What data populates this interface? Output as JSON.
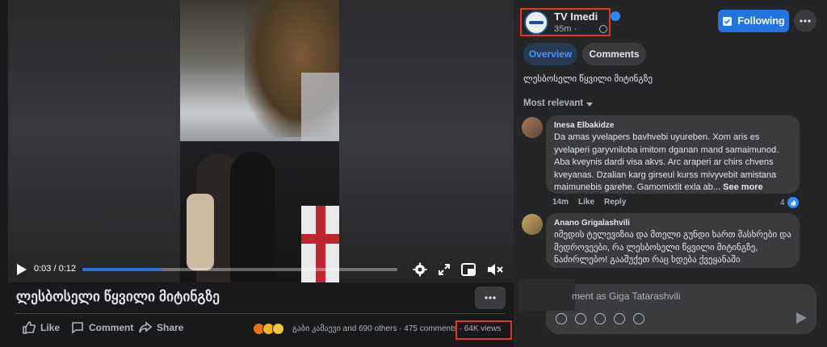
{
  "video": {
    "time_display": "0:03 / 0:12",
    "progress_fraction": 0.25
  },
  "post": {
    "title": "ლესბოსელი წყვილი მიტინგზე",
    "actions": {
      "like": "Like",
      "comment": "Comment",
      "share": "Share"
    },
    "stats": "გაბი კამაევი and 690 others  ·  475 comments  ·  64K views"
  },
  "page": {
    "name": "TV Imedi",
    "time": "35m ·",
    "follow_label": "Following"
  },
  "tabs": [
    {
      "label": "Overview",
      "active": true
    },
    {
      "label": "Comments",
      "active": false
    }
  ],
  "description": "ლესბოსელი წყვილი მიტინგზე",
  "sort_label": "Most relevant",
  "comments": [
    {
      "author": "Inesa Elbakidze",
      "text": "Da amas yvelapers bavhvebi uyureben. Xom aris es yvelaperi garyvniloba imitom dganan mand samaimunod. Aba kveynis dardi visa akvs. Arc araperi ar chirs chvens kveyanas. Dzalian karg girseul kurss mivyvebit amistana maimunebis garehe. Gamomixtit exla ab...",
      "see_more": "See more",
      "time": "14m",
      "like": "Like",
      "reply": "Reply",
      "reactions": "4"
    },
    {
      "author": "Anano Grigalashvili",
      "text": "იმედის ტელევიზია და მთელი გუნდი ხართ მასხრები და მედროვეები, რა ლესბოსელი წყვილი მიტინგზე, ნაძირლებო! გააშუქეთ რაც ხდება ქვეყანაში"
    }
  ],
  "composer": {
    "placeholder": "ment as Giga Tatarashvili"
  },
  "colors": {
    "accent": "#2374e1",
    "highlight_box": "#e8341c",
    "background_dark": "#18191a",
    "panel": "#242526"
  },
  "icons": [
    "play-icon",
    "gear-icon",
    "expand-icon",
    "picture-in-picture-icon",
    "mute-icon",
    "more-icon",
    "like-icon",
    "comment-icon",
    "share-icon",
    "verified-icon",
    "globe-icon",
    "following-icon",
    "caret-down-icon",
    "send-icon"
  ]
}
